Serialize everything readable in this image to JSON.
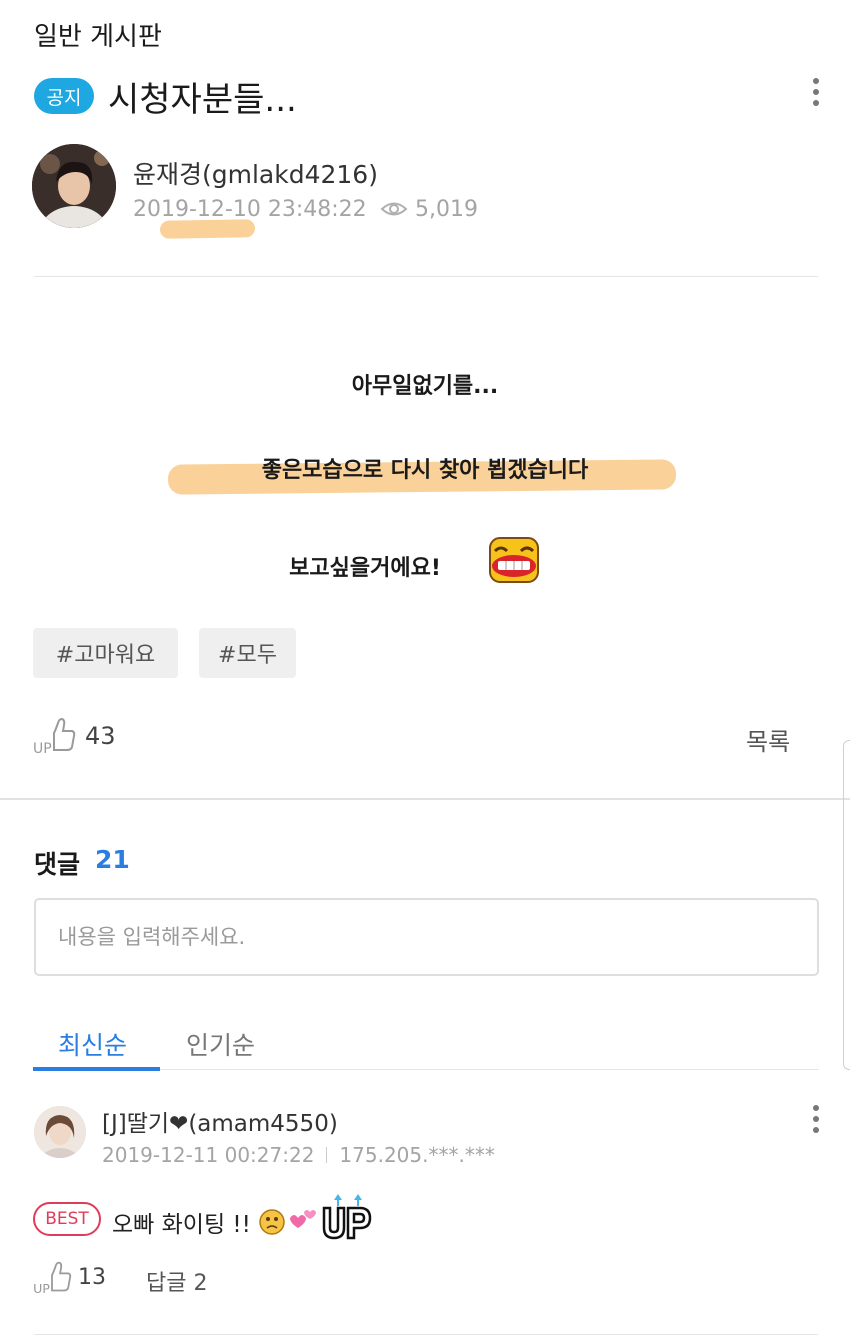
{
  "board": {
    "name": "일반 게시판"
  },
  "post": {
    "badge": "공지",
    "title": "시청자분들...",
    "author": "윤재경(gmlakd4216)",
    "date": "2019-12-10 23:48:22",
    "views": "5,019",
    "content": [
      "아무일없기를...",
      "좋은모습으로 다시 찾아 뵙겠습니다",
      "보고싶을거에요!"
    ],
    "tags": [
      "#고마워요",
      "#모두"
    ],
    "likes": "43",
    "list_label": "목록"
  },
  "comments": {
    "label": "댓글",
    "count": "21",
    "input_placeholder": "내용을 입력해주세요.",
    "tabs": [
      "최신순",
      "인기순"
    ],
    "items": [
      {
        "author": "[J]딸기❤(amam4550)",
        "date": "2019-12-11 00:27:22",
        "ip": "175.205.***.***",
        "badge": "BEST",
        "text": "오빠 화이팅 !!",
        "likes": "13",
        "reply_label": "답글 2"
      }
    ]
  },
  "icons": {
    "eye": "eye-icon",
    "like": "thumbs-up-icon",
    "more": "more-vertical-icon"
  },
  "colors": {
    "accent": "#2a7de1",
    "notice_badge": "#1ea7e0",
    "best_badge": "#e03c5a",
    "highlight": "#f7c47c"
  }
}
